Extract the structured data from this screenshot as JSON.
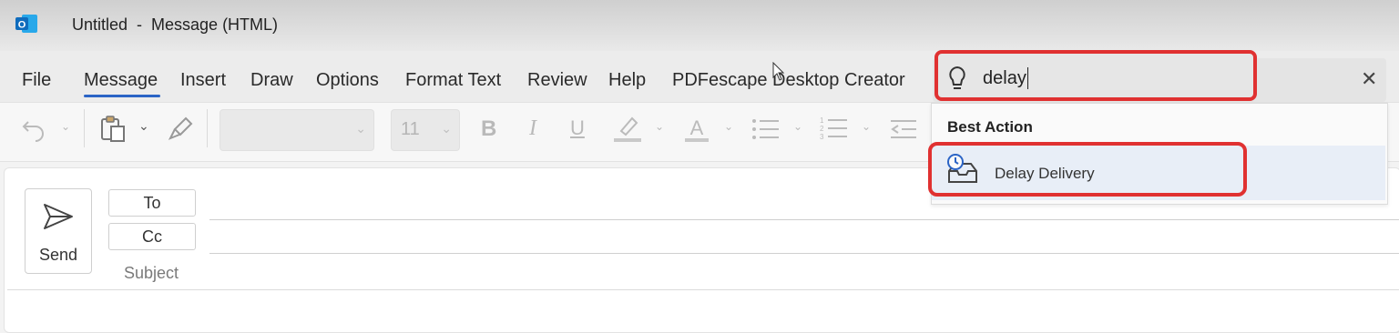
{
  "window": {
    "title": "Untitled  -  Message (HTML)"
  },
  "menu": {
    "items": [
      "File",
      "Message",
      "Insert",
      "Draw",
      "Options",
      "Format Text",
      "Review",
      "Help",
      "PDFescape Desktop Creator"
    ],
    "active": "Message"
  },
  "ribbon": {
    "font_size_value": "11",
    "font_name_value": ""
  },
  "search": {
    "value": "delay",
    "close_glyph": "✕"
  },
  "dropdown": {
    "heading": "Best Action",
    "items": [
      {
        "label": "Delay Delivery",
        "icon": "clock-inbox-icon"
      }
    ]
  },
  "compose": {
    "send_label": "Send",
    "to_label": "To",
    "cc_label": "Cc",
    "subject_label": "Subject"
  },
  "colors": {
    "accent": "#2b64c6",
    "highlight_outline": "#e03131",
    "outlook_blue": "#0f6cbd"
  }
}
